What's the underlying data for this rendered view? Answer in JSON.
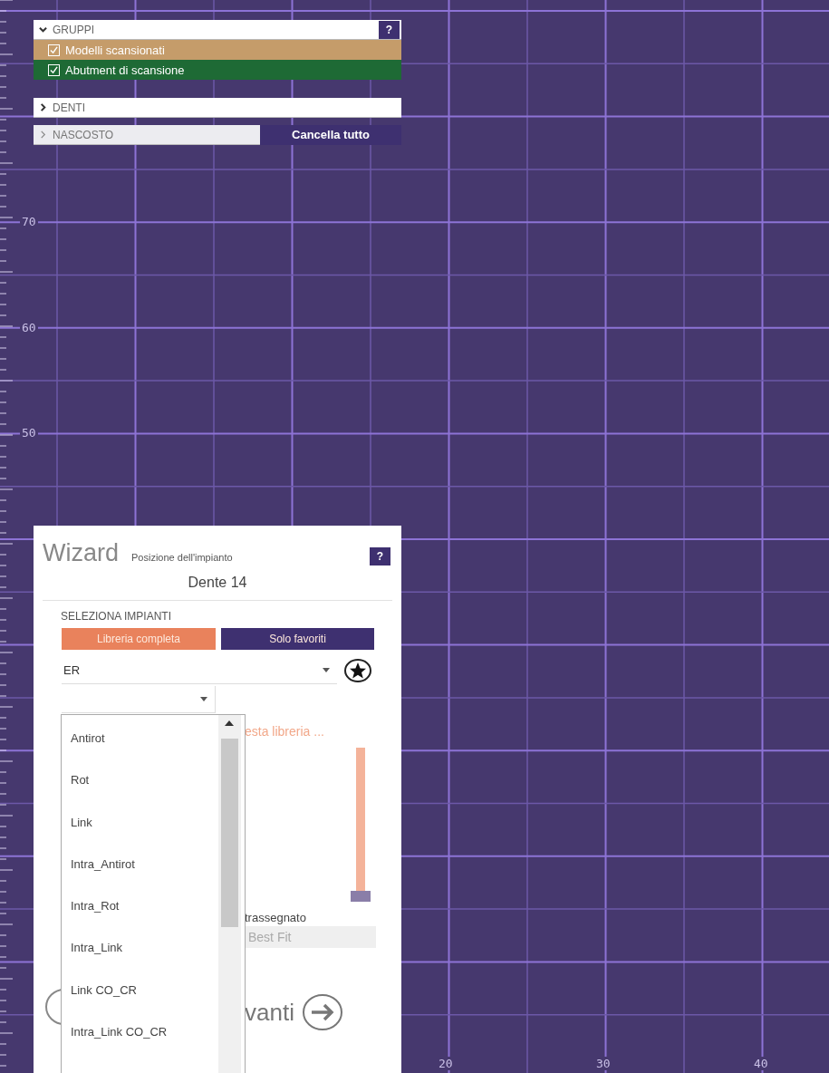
{
  "groups_panel": {
    "help": "?",
    "groups": [
      {
        "label": "GRUPPI",
        "expanded": true,
        "items": [
          {
            "label": "Modelli scansionati",
            "checked": true,
            "color": "#c59c6a"
          },
          {
            "label": "Abutment di scansione",
            "checked": true,
            "color": "#1e6a35"
          }
        ]
      },
      {
        "label": "DENTI",
        "expanded": false
      },
      {
        "label": "NASCOSTO",
        "expanded": false,
        "action": "Cancella tutto"
      }
    ]
  },
  "wizard": {
    "title": "Wizard",
    "step": "Posizione dell'impianto",
    "help": "?",
    "tooth": "Dente 14",
    "section": "SELEZIONA IMPIANTI",
    "library_tabs": [
      {
        "label": "Libreria completa",
        "selected": true
      },
      {
        "label": "Solo favoriti",
        "selected": false
      }
    ],
    "manufacturer": {
      "value": "ER"
    },
    "note": "esta libreria ...",
    "slider": {
      "level": 0
    },
    "marked": "trassegnato",
    "fit_button": "Best Fit",
    "next_button": "vanti",
    "dropdown_items": [
      {
        "label": "Antirot"
      },
      {
        "label": "Rot"
      },
      {
        "label": "Link"
      },
      {
        "label": "Intra_Antirot"
      },
      {
        "label": "Intra_Rot"
      },
      {
        "label": "Intra_Link"
      },
      {
        "label": "Link CO_CR"
      },
      {
        "label": "Intra_Link CO_CR"
      }
    ]
  },
  "axes": {
    "y_labels": [
      "70",
      "60",
      "50"
    ],
    "x_labels": [
      "20",
      "30",
      "40"
    ]
  }
}
